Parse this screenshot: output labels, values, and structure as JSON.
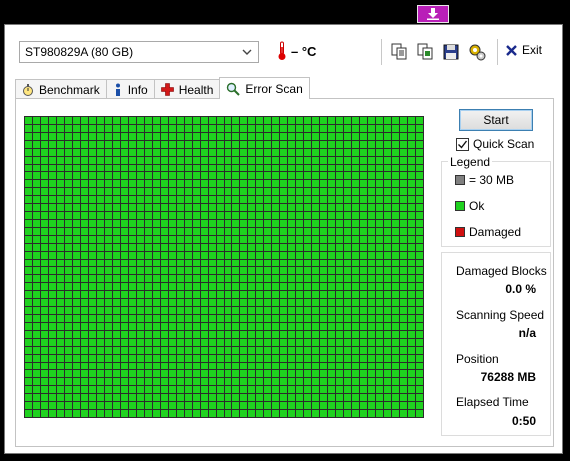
{
  "drive": {
    "selected": "ST980829A (80 GB)"
  },
  "temperature": "– °C",
  "toolbar": {
    "exit_label": "Exit"
  },
  "tabs": [
    {
      "label": "Benchmark"
    },
    {
      "label": "Info"
    },
    {
      "label": "Health"
    },
    {
      "label": "Error Scan"
    }
  ],
  "scan": {
    "start_label": "Start",
    "quick_scan_label": "Quick Scan",
    "quick_scan_checked": true
  },
  "legend": {
    "title": "Legend",
    "items": [
      {
        "label": "= 30 MB",
        "color": "#808080"
      },
      {
        "label": "Ok",
        "color": "#1fd21f"
      },
      {
        "label": "Damaged",
        "color": "#d01010"
      }
    ]
  },
  "stats": {
    "damaged_blocks_label": "Damaged Blocks",
    "damaged_blocks_value": "0.0 %",
    "speed_label": "Scanning Speed",
    "speed_value": "n/a",
    "position_label": "Position",
    "position_value": "76288 MB",
    "elapsed_label": "Elapsed Time",
    "elapsed_value": "0:50"
  },
  "grid": {
    "columns": 50,
    "rows": 38,
    "status": "ok",
    "ok_color": "#1fd21f"
  },
  "colors": {
    "title_button": "#b91fb8",
    "accent": "#3c7fb1"
  }
}
